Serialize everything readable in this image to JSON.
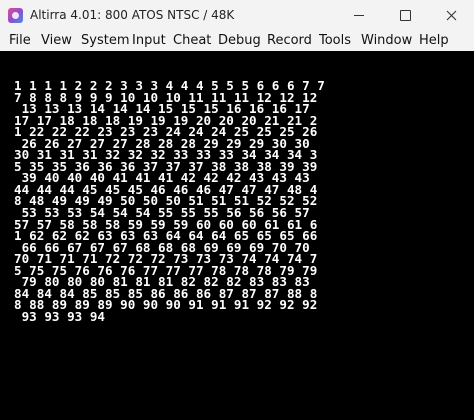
{
  "window": {
    "title": "Altirra 4.01: 800 ATOS NTSC / 48K",
    "app_icon": "altirra-icon",
    "controls": [
      "minimize-icon",
      "maximize-icon",
      "close-icon"
    ]
  },
  "menubar": {
    "items": [
      "File",
      "View",
      "System",
      "Input",
      "Cheat",
      "Debug",
      "Record",
      "Tools",
      "Window",
      "Help"
    ]
  },
  "screen": {
    "background": "#000000",
    "text_color": "#ffffff",
    "lines": [
      "1 1 1 1 2 2 2 3 3 3 4 4 4 5 5 5 6 6 6 7 7",
      "7 8 8 8 9 9 9 10 10 10 11 11 11 12 12 12",
      " 13 13 13 14 14 14 15 15 15 16 16 16 17",
      "17 17 18 18 18 19 19 19 20 20 20 21 21 2",
      "1 22 22 22 23 23 23 24 24 24 25 25 25 26",
      " 26 26 27 27 27 28 28 28 29 29 29 30 30",
      "30 31 31 31 32 32 32 33 33 33 34 34 34 3",
      "5 35 35 36 36 36 37 37 37 38 38 38 39 39",
      " 39 40 40 40 41 41 41 42 42 42 43 43 43",
      "44 44 44 45 45 45 46 46 46 47 47 47 48 4",
      "8 48 49 49 49 50 50 50 51 51 51 52 52 52",
      " 53 53 53 54 54 54 55 55 55 56 56 56 57",
      "57 57 58 58 58 59 59 59 60 60 60 61 61 6",
      "1 62 62 62 63 63 63 64 64 64 65 65 65 66",
      " 66 66 67 67 67 68 68 68 69 69 69 70 70",
      "70 71 71 71 72 72 72 73 73 73 74 74 74 7",
      "5 75 75 76 76 76 77 77 77 78 78 78 79 79",
      " 79 80 80 80 81 81 81 82 82 82 83 83 83",
      "84 84 84 85 85 85 86 86 86 87 87 87 88 8",
      "8 88 89 89 89 90 90 90 91 91 91 92 92 92",
      " 93 93 93 94"
    ]
  }
}
